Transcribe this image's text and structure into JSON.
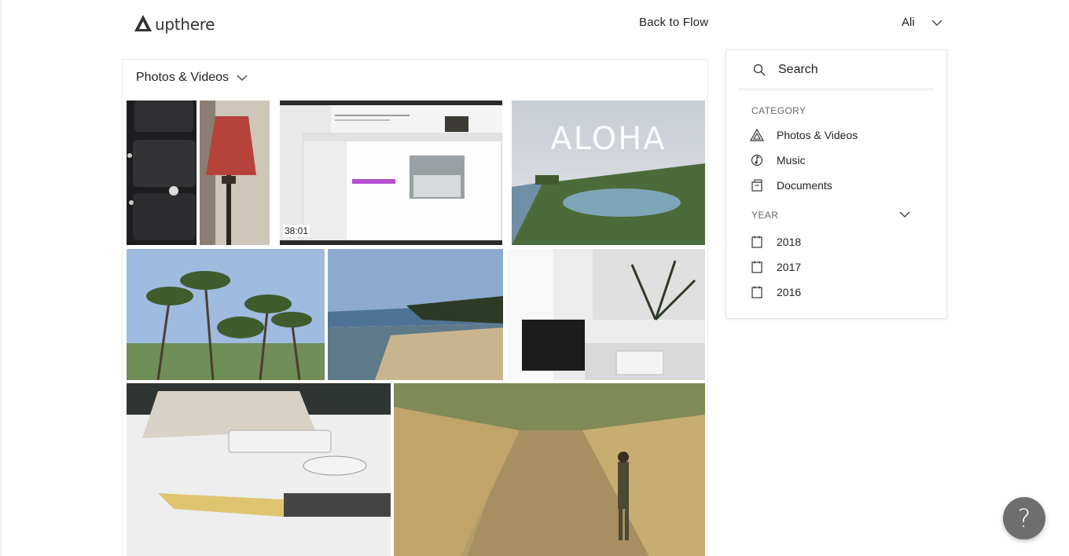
{
  "header": {
    "logo_text": "upthere",
    "back_link": "Back to Flow",
    "user_name": "Ali"
  },
  "gallery": {
    "title": "Photos & Videos",
    "video_duration": "38:01"
  },
  "filter": {
    "search_placeholder": "Search",
    "category_label": "CATEGORY",
    "categories": [
      {
        "label": "Photos & Videos",
        "icon": "photos-icon"
      },
      {
        "label": "Music",
        "icon": "music-icon"
      },
      {
        "label": "Documents",
        "icon": "documents-icon"
      }
    ],
    "year_label": "YEAR",
    "years": [
      {
        "label": "2018"
      },
      {
        "label": "2017"
      },
      {
        "label": "2016"
      }
    ]
  },
  "help": {
    "label": "?"
  }
}
